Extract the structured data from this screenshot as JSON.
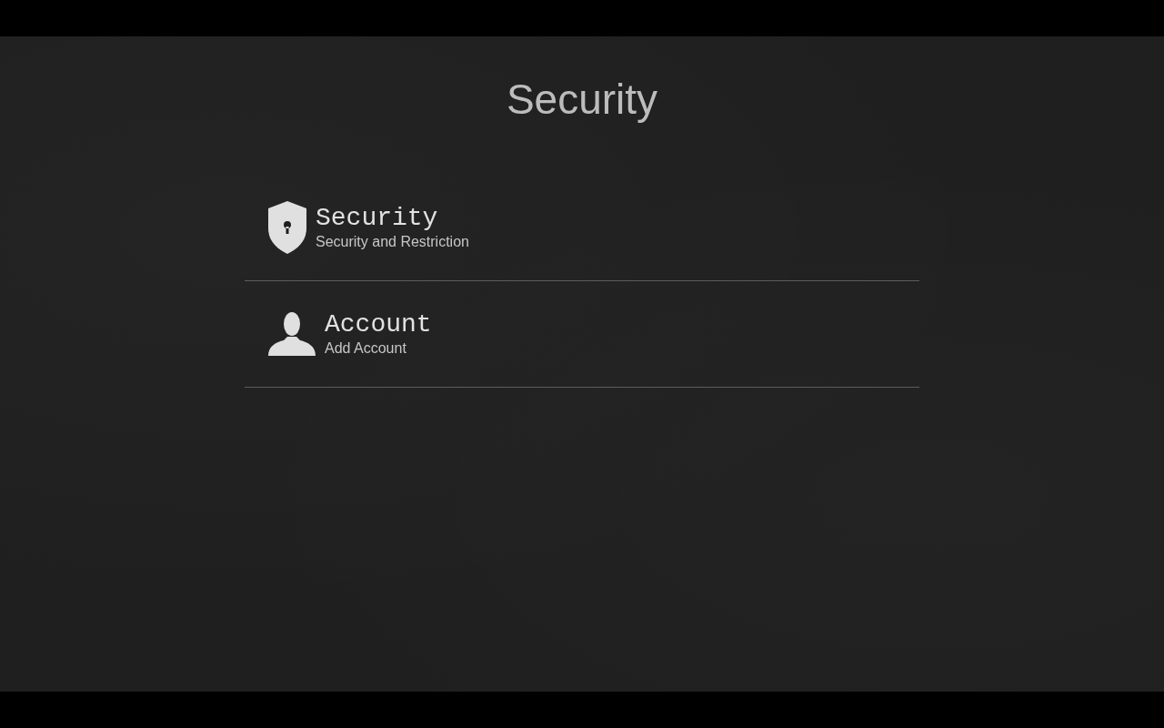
{
  "header": {
    "title": "Security"
  },
  "items": [
    {
      "title": "Security",
      "subtitle": "Security and Restriction"
    },
    {
      "title": "Account",
      "subtitle": "Add Account"
    }
  ]
}
